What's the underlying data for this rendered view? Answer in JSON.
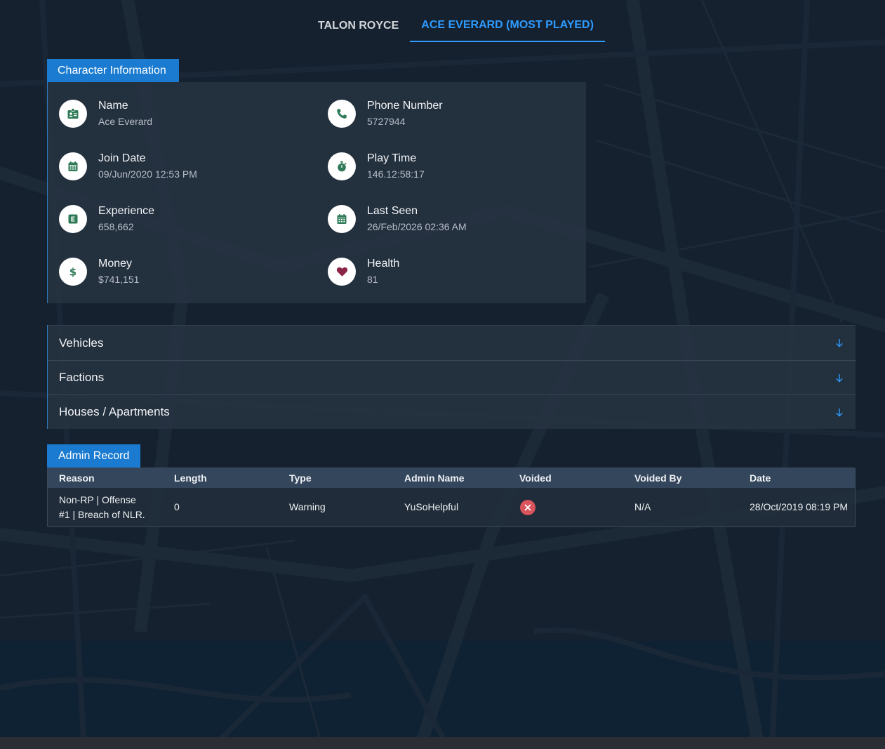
{
  "tabs": [
    {
      "label": "TALON ROYCE",
      "active": false
    },
    {
      "label": "ACE EVERARD (MOST PLAYED)",
      "active": true
    }
  ],
  "character_info": {
    "header": "Character Information",
    "items": [
      {
        "label": "Name",
        "value": "Ace Everard",
        "icon": "id-badge-icon"
      },
      {
        "label": "Phone Number",
        "value": "5727944",
        "icon": "phone-icon"
      },
      {
        "label": "Join Date",
        "value": "09/Jun/2020 12:53 PM",
        "icon": "calendar-icon"
      },
      {
        "label": "Play Time",
        "value": "146.12:58:17",
        "icon": "stopwatch-icon"
      },
      {
        "label": "Experience",
        "value": "658,662",
        "icon": "experience-icon"
      },
      {
        "label": "Last Seen",
        "value": "26/Feb/2026 02:36 AM",
        "icon": "calendar-icon"
      },
      {
        "label": "Money",
        "value": "$741,151",
        "icon": "dollar-icon"
      },
      {
        "label": "Health",
        "value": "81",
        "icon": "heart-icon"
      }
    ]
  },
  "sections": [
    {
      "title": "Vehicles"
    },
    {
      "title": "Factions"
    },
    {
      "title": "Houses / Apartments"
    }
  ],
  "admin_record": {
    "header": "Admin Record",
    "columns": [
      "Reason",
      "Length",
      "Type",
      "Admin Name",
      "Voided",
      "Voided By",
      "Date"
    ],
    "rows": [
      {
        "reason": "Non-RP | Offense #1 | Breach of NLR.",
        "length": "0",
        "type": "Warning",
        "admin_name": "YuSoHelpful",
        "voided": false,
        "voided_by": "N/A",
        "date": "28/Oct/2019 08:19 PM"
      }
    ]
  },
  "colors": {
    "accent": "#2e9bff",
    "chip": "#1a7bd0",
    "icon_green": "#2f7a57",
    "heart": "#8c2449",
    "void_red": "#d9545b"
  }
}
